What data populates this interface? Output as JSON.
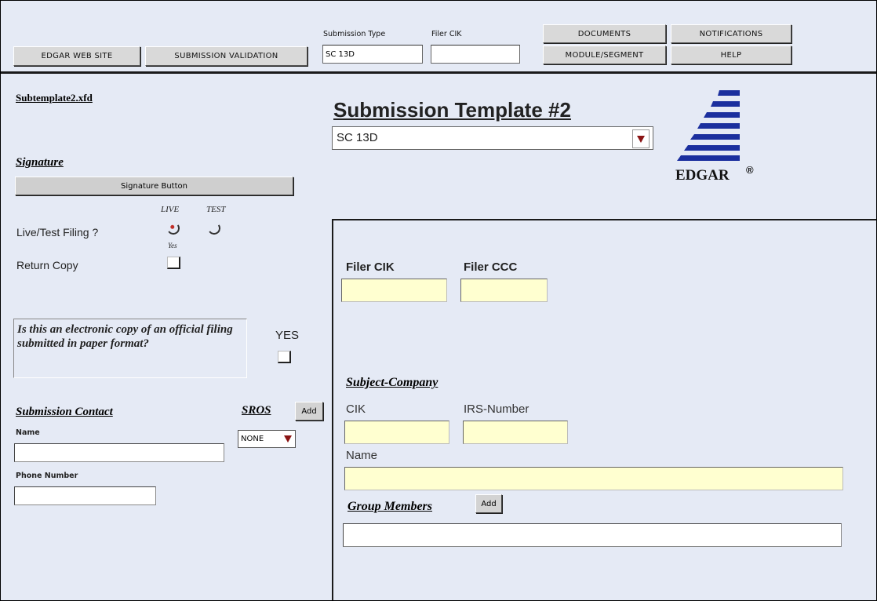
{
  "toolbar": {
    "edgar_web_site": "EDGAR WEB SITE",
    "submission_validation": "SUBMISSION VALIDATION",
    "submission_type_label": "Submission Type",
    "submission_type_value": "SC 13D",
    "filer_cik_label": "Filer CIK",
    "filer_cik_value": "",
    "documents": "DOCUMENTS",
    "notifications": "NOTIFICATIONS",
    "module_segment": "MODULE/SEGMENT",
    "help": "HELP"
  },
  "left": {
    "template_file": "Subtemplate2.xfd",
    "signature_title": "Signature",
    "signature_button": "Signature Button",
    "live_label": "LIVE",
    "test_label": "TEST",
    "live_test_label": "Live/Test Filing ?",
    "yes_small": "Yes",
    "return_copy_label": "Return Copy",
    "electronic_copy_question": "Is this an electronic copy of an official filing submitted in paper format?",
    "yes_label": "YES",
    "submission_contact_title": "Submission Contact",
    "sros_title": "SROS",
    "add_label": "Add",
    "sros_value": "NONE",
    "name_label": "Name",
    "phone_label": "Phone Number"
  },
  "header": {
    "title": "Submission Template #2",
    "type_select_value": "SC 13D",
    "logo_text": "EDGAR",
    "logo_mark": "®"
  },
  "right": {
    "filer_cik_label": "Filer CIK",
    "filer_ccc_label": "Filer CCC",
    "subject_company_title": "Subject-Company",
    "cik_label": "CIK",
    "irs_number_label": "IRS-Number",
    "name_label": "Name",
    "group_members_title": "Group Members",
    "add_label": "Add"
  },
  "colors": {
    "background": "#e5eaf5",
    "input_yellow": "#ffffd0",
    "logo_blue": "#1b2f9e",
    "arrow_red": "#8a1414"
  }
}
